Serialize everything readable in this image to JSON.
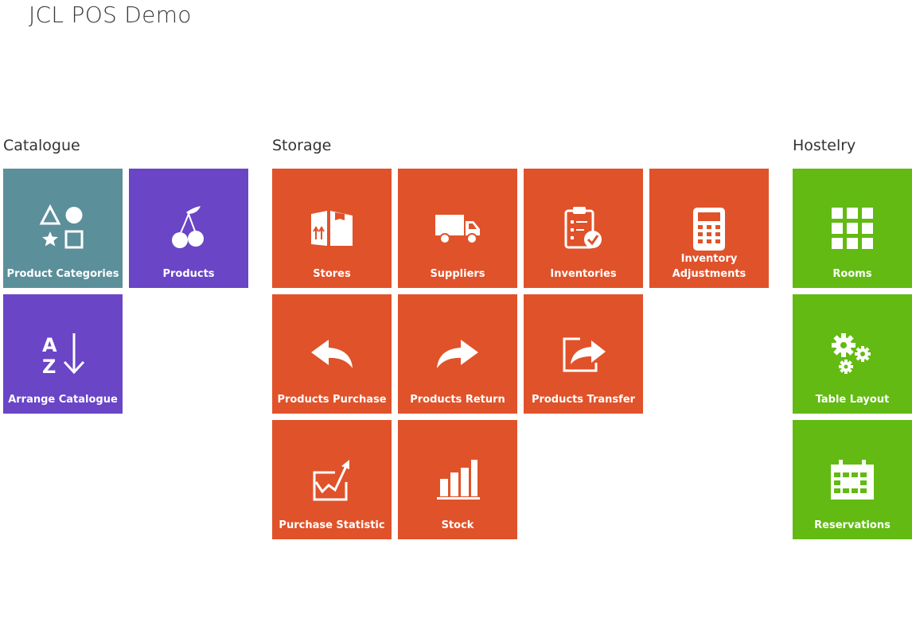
{
  "app": {
    "title": "JCL POS Demo"
  },
  "colors": {
    "teal": "#5b8f9a",
    "purple": "#6a45c6",
    "orange": "#e0522a",
    "green": "#62ba13"
  },
  "groups": {
    "catalogue": {
      "title": "Catalogue",
      "tiles": {
        "product_categories": {
          "label": "Product Categories",
          "icon": "shapes-icon"
        },
        "products": {
          "label": "Products",
          "icon": "cherries-icon"
        },
        "arrange_catalogue": {
          "label": "Arrange Catalogue",
          "icon": "sort-az-icon"
        }
      }
    },
    "storage": {
      "title": "Storage",
      "tiles": {
        "stores": {
          "label": "Stores",
          "icon": "box-icon"
        },
        "suppliers": {
          "label": "Suppliers",
          "icon": "truck-icon"
        },
        "inventories": {
          "label": "Inventories",
          "icon": "clipboard-check-icon"
        },
        "inventory_adjustments": {
          "label": "Inventory Adjustments",
          "icon": "calculator-icon"
        },
        "products_purchase": {
          "label": "Products Purchase",
          "icon": "arrow-back-icon"
        },
        "products_return": {
          "label": "Products Return",
          "icon": "arrow-forward-icon"
        },
        "products_transfer": {
          "label": "Products Transfer",
          "icon": "share-icon"
        },
        "purchase_statistic": {
          "label": "Purchase Statistic",
          "icon": "trend-chart-icon"
        },
        "stock": {
          "label": "Stock",
          "icon": "bar-chart-icon"
        }
      }
    },
    "hostelry": {
      "title": "Hostelry",
      "tiles": {
        "rooms": {
          "label": "Rooms",
          "icon": "grid-icon"
        },
        "table_layout": {
          "label": "Table Layout",
          "icon": "gears-icon"
        },
        "reservations": {
          "label": "Reservations",
          "icon": "calendar-icon"
        }
      }
    }
  }
}
